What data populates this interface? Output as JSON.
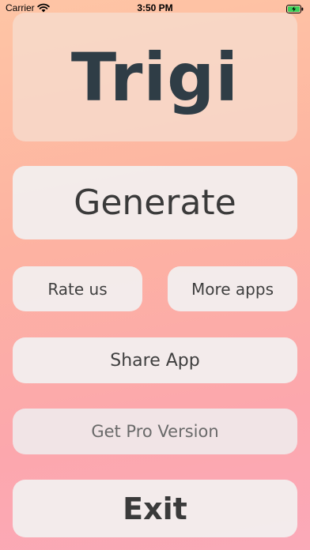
{
  "status_bar": {
    "carrier": "Carrier",
    "time": "3:50 PM",
    "wifi_icon": "wifi-icon",
    "battery_icon": "battery-charging-icon"
  },
  "app": {
    "title": "Trigi"
  },
  "buttons": {
    "generate": "Generate",
    "rate_us": "Rate us",
    "more_apps": "More apps",
    "share_app": "Share App",
    "get_pro": "Get Pro Version",
    "exit": "Exit"
  },
  "colors": {
    "background_top": "#fec5a5",
    "background_bottom": "#fba9b9",
    "title_text": "#2f3d46",
    "button_bg": "#f2eeee",
    "battery_green": "#3bd15a"
  }
}
